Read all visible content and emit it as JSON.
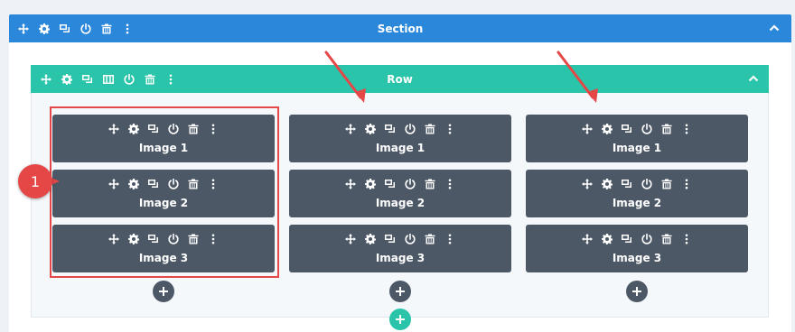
{
  "section": {
    "title": "Section"
  },
  "row": {
    "title": "Row"
  },
  "columns": [
    {
      "modules": [
        {
          "label": "Image 1"
        },
        {
          "label": "Image 2"
        },
        {
          "label": "Image 3"
        }
      ]
    },
    {
      "modules": [
        {
          "label": "Image 1"
        },
        {
          "label": "Image 2"
        },
        {
          "label": "Image 3"
        }
      ]
    },
    {
      "modules": [
        {
          "label": "Image 1"
        },
        {
          "label": "Image 2"
        },
        {
          "label": "Image 3"
        }
      ]
    }
  ],
  "annotation": {
    "badge_number": "1"
  },
  "colors": {
    "section_bar": "#2b87da",
    "row_bar": "#29c4a9",
    "module_bg": "#4c5866",
    "highlight": "#e54747"
  },
  "icons": [
    "move-icon",
    "settings-icon",
    "duplicate-icon",
    "columns-icon",
    "power-icon",
    "trash-icon",
    "more-icon",
    "chevron-up-icon",
    "plus-icon"
  ]
}
